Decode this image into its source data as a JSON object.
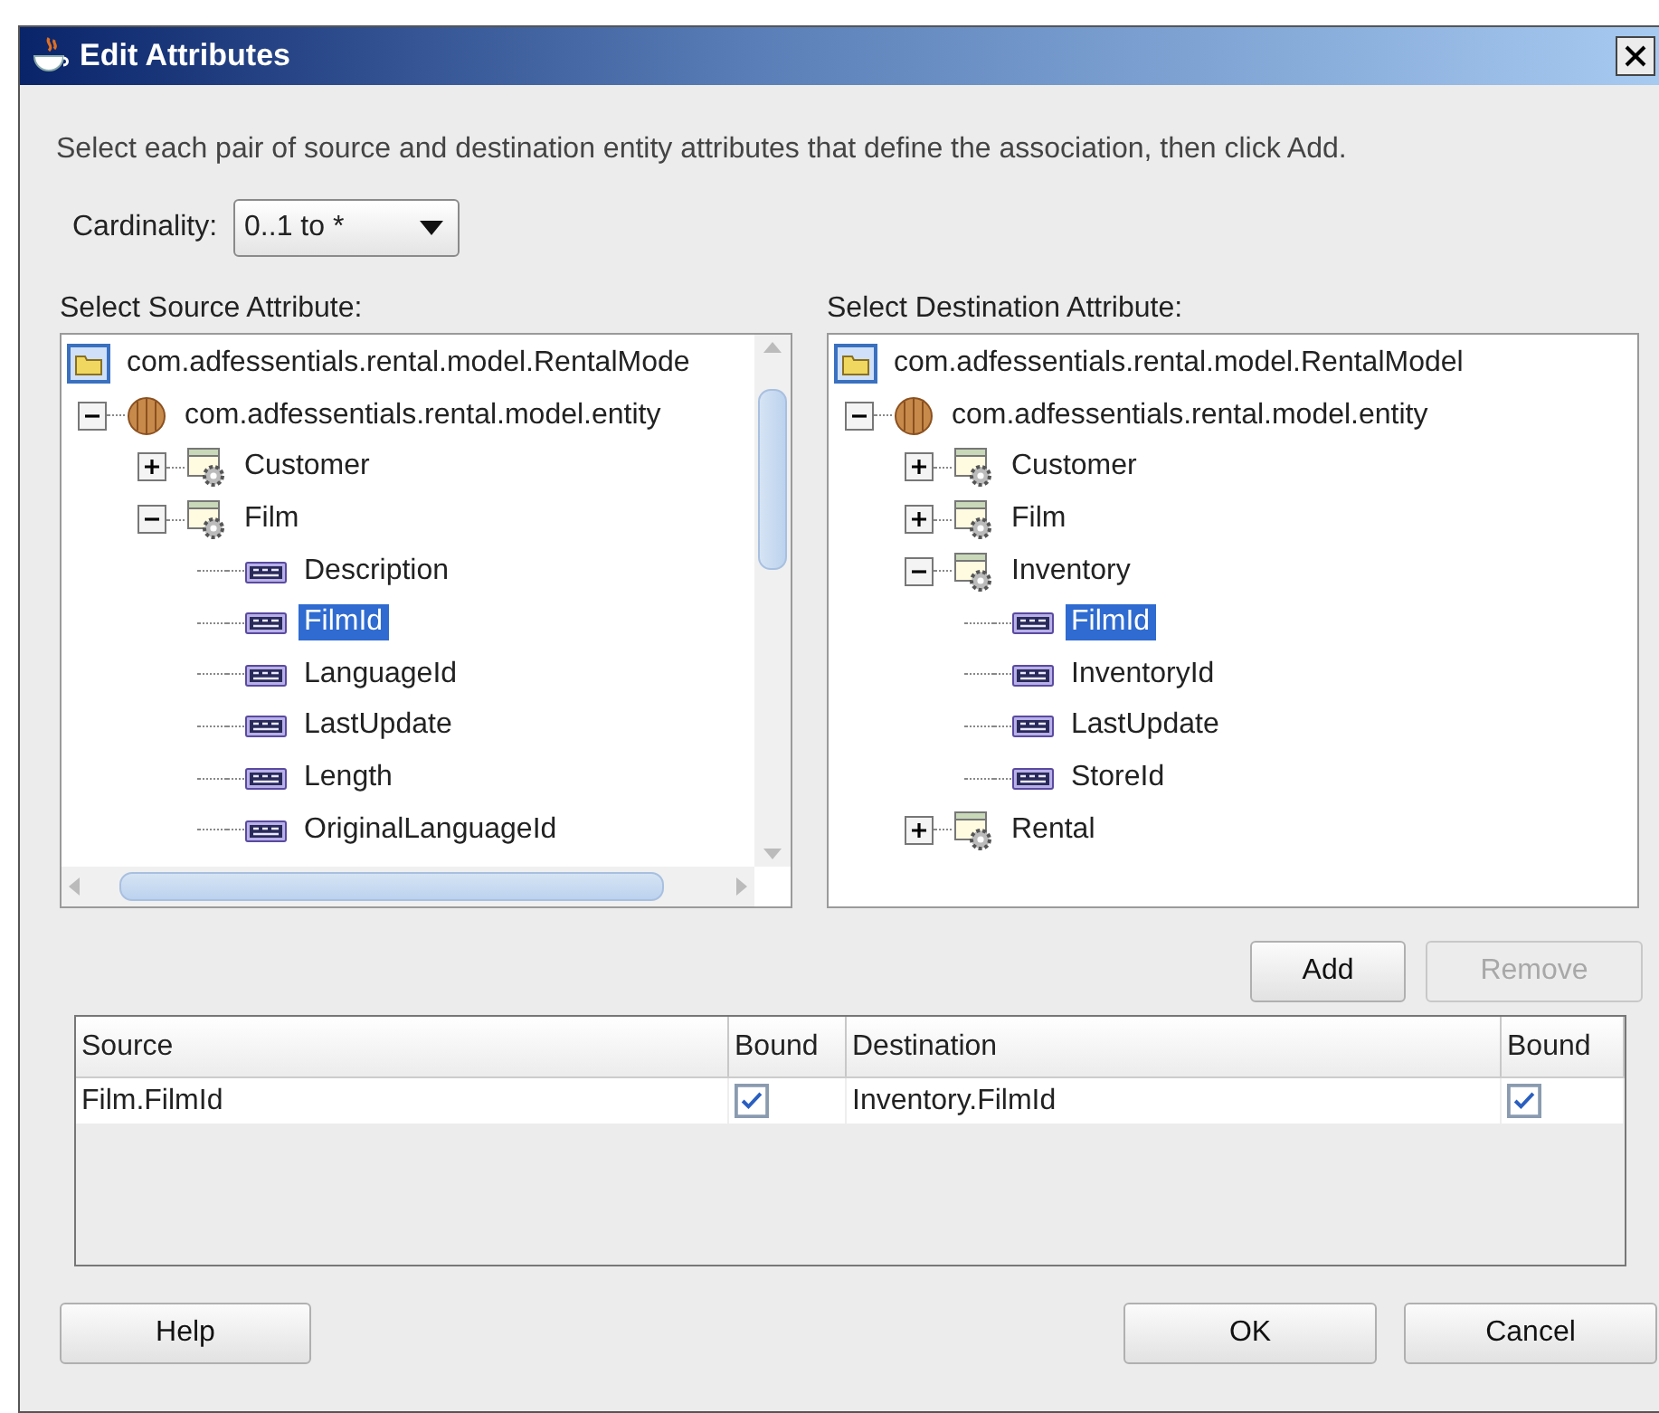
{
  "window": {
    "title": "Edit Attributes"
  },
  "instructions": "Select each pair of source and destination entity attributes that define the association, then click Add.",
  "cardinality": {
    "label": "Cardinality:",
    "value": "0..1 to *"
  },
  "source_tree": {
    "label": "Select Source Attribute:",
    "scrollbars": true,
    "nodes": [
      {
        "kind": "project",
        "label": "com.adfessentials.rental.model.RentalMode",
        "children": [
          {
            "kind": "package",
            "label": "com.adfessentials.rental.model.entity",
            "expanded": true,
            "children": [
              {
                "kind": "entity",
                "label": "Customer",
                "expanded": false
              },
              {
                "kind": "entity",
                "label": "Film",
                "expanded": true,
                "children": [
                  {
                    "kind": "attribute",
                    "label": "Description",
                    "selected": false
                  },
                  {
                    "kind": "attribute",
                    "label": "FilmId",
                    "selected": true
                  },
                  {
                    "kind": "attribute",
                    "label": "LanguageId",
                    "selected": false
                  },
                  {
                    "kind": "attribute",
                    "label": "LastUpdate",
                    "selected": false
                  },
                  {
                    "kind": "attribute",
                    "label": "Length",
                    "selected": false
                  },
                  {
                    "kind": "attribute",
                    "label": "OriginalLanguageId",
                    "selected": false
                  }
                ]
              }
            ]
          }
        ]
      }
    ]
  },
  "destination_tree": {
    "label": "Select Destination Attribute:",
    "scrollbars": false,
    "nodes": [
      {
        "kind": "project",
        "label": "com.adfessentials.rental.model.RentalModel",
        "children": [
          {
            "kind": "package",
            "label": "com.adfessentials.rental.model.entity",
            "expanded": true,
            "children": [
              {
                "kind": "entity",
                "label": "Customer",
                "expanded": false
              },
              {
                "kind": "entity",
                "label": "Film",
                "expanded": false
              },
              {
                "kind": "entity",
                "label": "Inventory",
                "expanded": true,
                "children": [
                  {
                    "kind": "attribute",
                    "label": "FilmId",
                    "selected": true
                  },
                  {
                    "kind": "attribute",
                    "label": "InventoryId",
                    "selected": false
                  },
                  {
                    "kind": "attribute",
                    "label": "LastUpdate",
                    "selected": false
                  },
                  {
                    "kind": "attribute",
                    "label": "StoreId",
                    "selected": false
                  }
                ]
              },
              {
                "kind": "entity",
                "label": "Rental",
                "expanded": false
              }
            ]
          }
        ]
      }
    ]
  },
  "pair_buttons": [
    {
      "label": "Add",
      "disabled": false
    },
    {
      "label": "Remove",
      "disabled": true
    }
  ],
  "mappings": {
    "columns": [
      {
        "label": "Source",
        "kind": "text"
      },
      {
        "label": "Bound",
        "kind": "check"
      },
      {
        "label": "Destination",
        "kind": "text"
      },
      {
        "label": "Bound",
        "kind": "check"
      }
    ],
    "rows": [
      {
        "cells": [
          {
            "text": "Film.FilmId"
          },
          {
            "checked": true
          },
          {
            "text": "Inventory.FilmId"
          },
          {
            "checked": true
          }
        ]
      }
    ]
  },
  "footer_buttons": [
    {
      "label": "Help",
      "disabled": false
    },
    {
      "label": "OK",
      "disabled": false
    },
    {
      "label": "Cancel",
      "disabled": false
    }
  ]
}
